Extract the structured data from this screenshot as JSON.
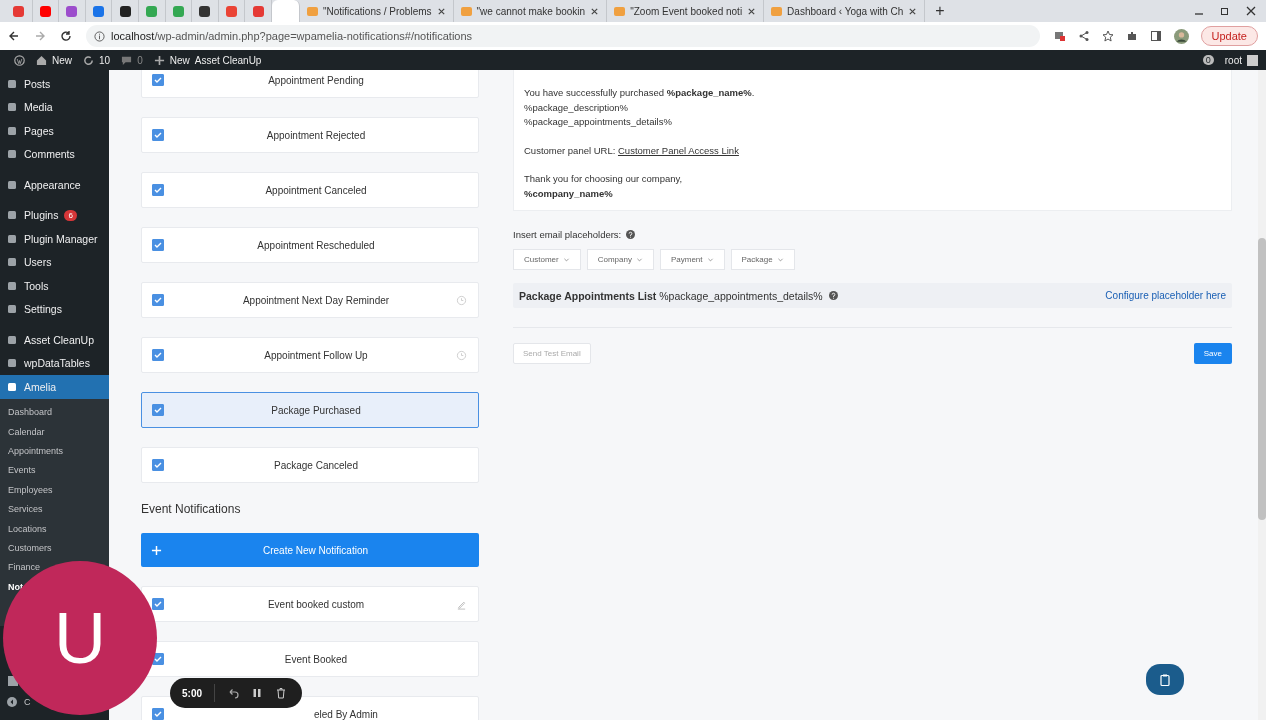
{
  "browser": {
    "icon_tabs": [
      {
        "color": "#e53935"
      },
      {
        "color": "#ff0000"
      },
      {
        "color": "#9c4dcc"
      },
      {
        "color": "#1a73e8"
      },
      {
        "color": "#222222"
      },
      {
        "color": "#34a853"
      },
      {
        "color": "#34a853"
      },
      {
        "color": "#333333"
      },
      {
        "color": "#ea4335"
      },
      {
        "color": "#e53935"
      }
    ],
    "tabs": [
      {
        "selected": true
      },
      {
        "title": "\"Notifications / Problems",
        "selected": false
      },
      {
        "title": "\"we cannot make bookin",
        "selected": false
      },
      {
        "title": "\"Zoom Event booked noti",
        "selected": false
      },
      {
        "title": "Dashboard ‹ Yoga with Ch",
        "selected": false
      }
    ],
    "new_tab": "+",
    "url_host": "localhost",
    "url_path": "/wp-admin/admin.php?page=wpamelia-notifications#/notifications",
    "update_button": "Update"
  },
  "admin_bar": {
    "new_label": "New",
    "updates": "10",
    "comments": "0",
    "add_new": "New",
    "asset_cleanup": "Asset CleanUp",
    "notif_count": "0",
    "user": "root"
  },
  "sidebar": {
    "groups": [
      [
        {
          "label": "Posts",
          "selected": false
        },
        {
          "label": "Media",
          "selected": false
        },
        {
          "label": "Pages",
          "selected": false
        },
        {
          "label": "Comments",
          "selected": false
        }
      ],
      [
        {
          "label": "Appearance",
          "selected": false
        }
      ],
      [
        {
          "label": "Plugins",
          "selected": false,
          "badge": "6"
        },
        {
          "label": "Plugin Manager",
          "selected": false
        },
        {
          "label": "Users",
          "selected": false
        },
        {
          "label": "Tools",
          "selected": false
        },
        {
          "label": "Settings",
          "selected": false
        }
      ],
      [
        {
          "label": "Asset CleanUp",
          "selected": false
        },
        {
          "label": "wpDataTables",
          "selected": false
        },
        {
          "label": "Amelia",
          "selected": true
        }
      ]
    ],
    "submenu": [
      {
        "label": "Dashboard",
        "selected": false
      },
      {
        "label": "Calendar",
        "selected": false
      },
      {
        "label": "Appointments",
        "selected": false
      },
      {
        "label": "Events",
        "selected": false
      },
      {
        "label": "Employees",
        "selected": false
      },
      {
        "label": "Services",
        "selected": false
      },
      {
        "label": "Locations",
        "selected": false
      },
      {
        "label": "Customers",
        "selected": false
      },
      {
        "label": "Finance",
        "selected": false
      },
      {
        "label": "Not",
        "selected": true
      }
    ],
    "collapse": "C"
  },
  "notifications": [
    {
      "label": "Appointment Pending",
      "checked": true,
      "selected": false,
      "kind": "plain"
    },
    {
      "label": "Appointment Rejected",
      "checked": true,
      "selected": false,
      "kind": "plain"
    },
    {
      "label": "Appointment Canceled",
      "checked": true,
      "selected": false,
      "kind": "plain"
    },
    {
      "label": "Appointment Rescheduled",
      "checked": true,
      "selected": false,
      "kind": "plain"
    },
    {
      "label": "Appointment Next Day Reminder",
      "checked": true,
      "selected": false,
      "kind": "scheduled"
    },
    {
      "label": "Appointment Follow Up",
      "checked": true,
      "selected": false,
      "kind": "scheduled"
    },
    {
      "label": "Package Purchased",
      "checked": true,
      "selected": true,
      "kind": "plain"
    },
    {
      "label": "Package Canceled",
      "checked": true,
      "selected": false,
      "kind": "plain"
    }
  ],
  "event_section": {
    "title": "Event Notifications",
    "create_button": "Create New Notification",
    "items": [
      {
        "label": "Event booked custom",
        "checked": true,
        "selected": false,
        "kind": "custom"
      },
      {
        "label": "Event Booked",
        "checked": true,
        "selected": false,
        "kind": "plain"
      },
      {
        "label": "eled By Admin",
        "checked": true,
        "selected": false,
        "kind": "partly_hidden"
      }
    ]
  },
  "email": {
    "purchase_lines": [
      "You have successfully purchased **%package_name%**.",
      "%package_description%",
      "%package_appointments_details%"
    ],
    "url_label": "Customer panel URL:",
    "url_link": "Customer Panel Access Link",
    "closing_lines": [
      "Thank you for choosing our company,",
      "**%company_name%**"
    ],
    "placeholders_label": "Insert email placeholders:",
    "dropdowns": [
      "Customer",
      "Company",
      "Payment",
      "Package"
    ],
    "package_list_title": "Package Appointments List",
    "package_list_code": "%package_appointments_details%",
    "configure_link": "Configure placeholder here",
    "test_button": "Send Test Email",
    "save_button": "Save"
  },
  "recorder": {
    "avatar_letter": "U",
    "time": "5:00"
  }
}
